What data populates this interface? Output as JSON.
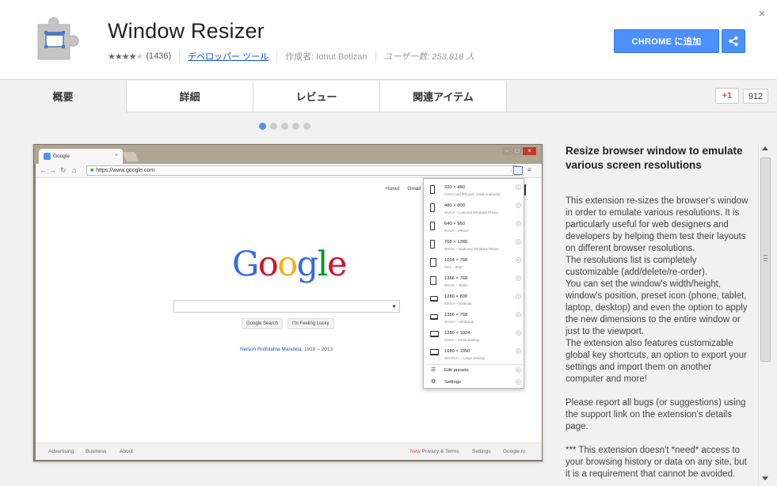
{
  "header": {
    "title": "Window Resizer",
    "rating_stars": "★★★★",
    "rating_empty": "★",
    "rating_count": "(1436)",
    "category": "デベロッパー ツール",
    "author": "作成者: Ionut Botizan",
    "users": "ユーザー数: 253,818 人",
    "add_button": "CHROME に追加",
    "close": "×"
  },
  "tabs": [
    {
      "label": "概要",
      "active": true
    },
    {
      "label": "詳細",
      "active": false
    },
    {
      "label": "レビュー",
      "active": false
    },
    {
      "label": "関連アイテム",
      "active": false
    }
  ],
  "social": {
    "gplus_label": "+1",
    "gplus_count": "912"
  },
  "carousel": {
    "count": 5,
    "active_index": 0
  },
  "screenshot": {
    "tab_title": "Google",
    "url": "https://www.google.com",
    "top_links": [
      "+Ionut",
      "Gmail"
    ],
    "logo_letters": [
      {
        "ch": "G",
        "color": "#3369e8"
      },
      {
        "ch": "o",
        "color": "#d50f25"
      },
      {
        "ch": "o",
        "color": "#eeb211"
      },
      {
        "ch": "g",
        "color": "#3369e8"
      },
      {
        "ch": "l",
        "color": "#009925"
      },
      {
        "ch": "e",
        "color": "#d50f25"
      }
    ],
    "buttons": [
      "Google Search",
      "I'm Feeling Lucky"
    ],
    "doodle_link": "Nelson Rolihlahla Mandela",
    "doodle_years": ", 1918 – 2013",
    "footer": {
      "advertising": "Advertising",
      "business": "Business",
      "about": "About",
      "new": "New",
      "privacy": "Privacy & Terms",
      "settings": "Settings",
      "domain": "Google.ro"
    },
    "resolutions": [
      {
        "name": "320 × 480",
        "desc": "HVGA (old iPhones, small Androids)",
        "icon": "phone",
        "num": "1"
      },
      {
        "name": "480 × 800",
        "desc": "WVGA – Low-end Windows Phone",
        "icon": "phone",
        "num": "2"
      },
      {
        "name": "640 × 960",
        "desc": "DVGA – iPhone",
        "icon": "phone",
        "num": "3"
      },
      {
        "name": "768 × 1280",
        "desc": "WXGA – High-end Windows Phone",
        "icon": "phone",
        "num": "4"
      },
      {
        "name": "1024 × 768",
        "desc": "XGA – iPad",
        "icon": "tablet",
        "num": "5"
      },
      {
        "name": "1366 × 768",
        "desc": "WXGA – Tablet",
        "icon": "tablet",
        "num": "6"
      },
      {
        "name": "1280 × 800",
        "desc": "WXGA – Netbook",
        "icon": "laptop",
        "num": "7"
      },
      {
        "name": "1366 × 768",
        "desc": "WXGA – Ultrabook",
        "icon": "laptop",
        "num": "8"
      },
      {
        "name": "1280 × 1024",
        "desc": "SXGA – Small desktop",
        "icon": "desktop",
        "num": "9"
      },
      {
        "name": "1680 × 1050",
        "desc": "WSXGA+ – Large desktop",
        "icon": "desktop",
        "num": "0"
      }
    ],
    "edit_presets": "Edit presets",
    "settings_label": "Settings"
  },
  "description": {
    "heading": "Resize browser window to emulate various screen resolutions",
    "paragraphs": [
      "This extension re-sizes the browser's window in order to emulate various resolutions. It is particularly useful for web designers and developers by helping them test their layouts on different browser resolutions.",
      "The resolutions list is completely customizable (add/delete/re-order).",
      "You can set the window's width/height, window's position, preset icon (phone, tablet, laptop, desktop) and even the option to apply the new dimensions to the entire window or just to the viewport.",
      "The extension also features customizable global key shortcuts, an option to export your settings and import them on another computer and more!",
      "",
      "Please report all bugs (or suggestions) using the support link on the extension's details page.",
      "",
      "*** This extension doesn't *need* access to your browsing history or data on any site, but it is a requirement that cannot be avoided."
    ]
  },
  "colors": {
    "accent": "#4d90fe",
    "gplus": "#dd4b39"
  }
}
